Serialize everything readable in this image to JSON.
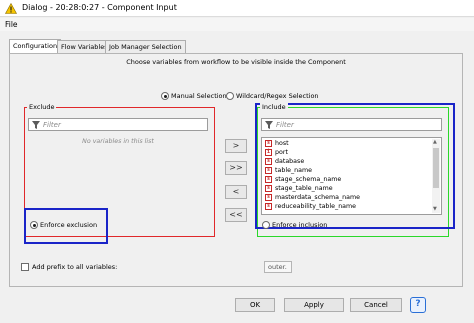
{
  "window": {
    "title": "Dialog - 20:28:0:27 - Component Input",
    "icon": "warning-triangle-icon"
  },
  "menu": {
    "file": "File"
  },
  "tabs": [
    {
      "label": "Configuration",
      "active": true
    },
    {
      "label": "Flow Variables",
      "active": false
    },
    {
      "label": "Job Manager Selection",
      "active": false
    }
  ],
  "instruction": "Choose variables from workflow to be visible inside the Component",
  "mode": {
    "manual": "Manual Selection",
    "wildcard": "Wildcard/Regex Selection",
    "selected": "manual"
  },
  "exclude": {
    "title": "Exclude",
    "filter_placeholder": "Filter",
    "empty_text": "No variables in this list",
    "enforce_label": "Enforce exclusion",
    "enforce_selected": true
  },
  "include": {
    "title": "Include",
    "filter_placeholder": "Filter",
    "items": [
      "host",
      "port",
      "database",
      "table_name",
      "stage_schema_name",
      "stage_table_name",
      "masterdata_schema_name",
      "reduceability_table_name"
    ],
    "item_types": [
      "s",
      "i",
      "s",
      "s",
      "s",
      "s",
      "s",
      "s"
    ],
    "enforce_label": "Enforce inclusion",
    "enforce_selected": false
  },
  "move_buttons": {
    "add": ">",
    "add_all": ">>",
    "remove": "<",
    "remove_all": "<<"
  },
  "prefix": {
    "label": "Add prefix to all variables:",
    "checked": false,
    "value": "outer."
  },
  "footer": {
    "ok": "OK",
    "apply": "Apply",
    "cancel": "Cancel",
    "help": "?"
  },
  "colors": {
    "annotation_red": "#e0282a",
    "annotation_blue": "#1a24c8",
    "annotation_green": "#2ad82a",
    "string_icon": "#c62828"
  }
}
